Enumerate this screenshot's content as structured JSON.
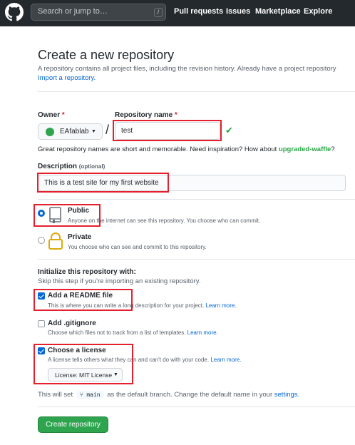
{
  "header": {
    "search_placeholder": "Search or jump to…",
    "slash_key": "/",
    "nav": [
      "Pull requests",
      "Issues",
      "Marketplace",
      "Explore"
    ]
  },
  "page": {
    "title": "Create a new repository",
    "subtitle": "A repository contains all project files, including the revision history. Already have a project repository",
    "import_link": "Import a repository."
  },
  "owner": {
    "label": "Owner",
    "required_mark": "*",
    "value": "EAfablab"
  },
  "repo_name": {
    "label": "Repository name",
    "required_mark": "*",
    "value": "test",
    "hint_prefix": "Great repository names are short and memorable. Need inspiration? How about",
    "hint_suggestion": "upgraded-waffle",
    "hint_suffix": "?"
  },
  "description": {
    "label": "Description",
    "optional": "(optional)",
    "value": "This is a test site for my first website"
  },
  "visibility": {
    "public": {
      "title": "Public",
      "desc": "Anyone on the internet can see this repository. You choose who can commit.",
      "selected": true
    },
    "private": {
      "title": "Private",
      "desc": "You choose who can see and commit to this repository.",
      "selected": false
    }
  },
  "init": {
    "title": "Initialize this repository with:",
    "subtitle": "Skip this step if you’re importing an existing repository.",
    "readme": {
      "title": "Add a README file",
      "desc": "This is where you can write a long description for your project.",
      "link": "Learn more.",
      "checked": true
    },
    "gitignore": {
      "title": "Add .gitignore",
      "desc": "Choose which files not to track from a list of templates.",
      "link": "Learn more.",
      "checked": false
    },
    "license": {
      "title": "Choose a license",
      "desc": "A license tells others what they can and can't do with your code.",
      "link": "Learn more.",
      "checked": true,
      "selected": "License: MIT License"
    }
  },
  "branch": {
    "prefix": "This will set",
    "branch_name": "main",
    "middle": "as the default branch. Change the default name in your",
    "settings_link": "settings",
    "suffix": "."
  },
  "submit": {
    "label": "Create repository"
  },
  "colors": {
    "accent": "#0366d6",
    "success": "#2ea44f",
    "annotation": "#e5202e"
  }
}
